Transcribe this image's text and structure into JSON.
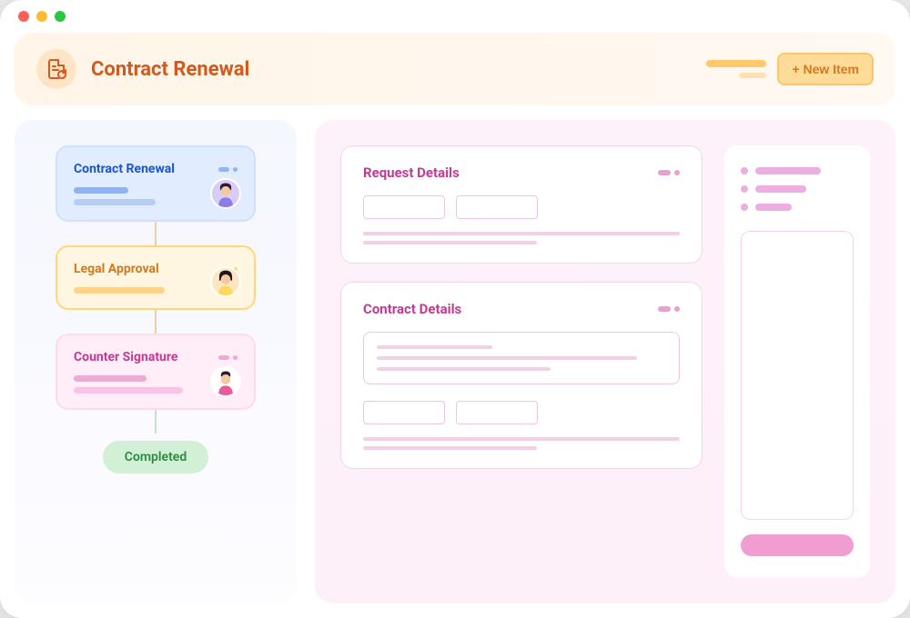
{
  "header": {
    "title": "Contract Renewal",
    "new_item_label": "+ New Item"
  },
  "workflow": {
    "steps": [
      {
        "title": "Contract Renewal",
        "color": "blue"
      },
      {
        "title": "Legal Approval",
        "color": "yellow"
      },
      {
        "title": "Counter Signature",
        "color": "pink"
      }
    ],
    "completed_label": "Completed"
  },
  "detail_panels": [
    {
      "title": "Request Details"
    },
    {
      "title": "Contract Details"
    }
  ]
}
